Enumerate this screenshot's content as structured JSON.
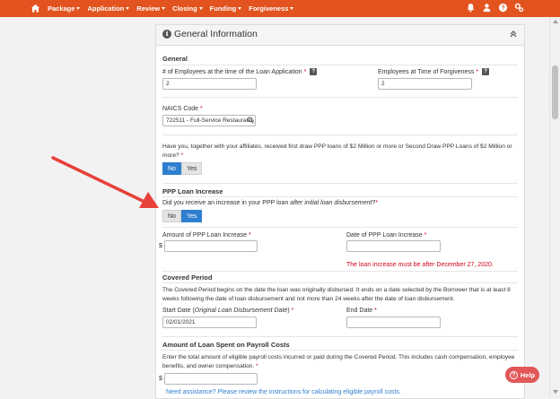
{
  "nav": {
    "items": [
      {
        "label": "Package"
      },
      {
        "label": "Application"
      },
      {
        "label": "Review"
      },
      {
        "label": "Closing"
      },
      {
        "label": "Funding"
      },
      {
        "label": "Forgiveness"
      }
    ],
    "right_icons": [
      "bell-icon",
      "user-icon",
      "question-icon",
      "settings-icon"
    ],
    "bar_color": "#e2531f"
  },
  "panel": {
    "title": "General Information",
    "general": {
      "heading": "General",
      "employees_loan_label": "# of Employees at the time of the Loan Application",
      "employees_loan_value": "2",
      "employees_forgiveness_label": "Employees at Time of Forgiveness",
      "employees_forgiveness_value": "2",
      "naics_label": "NAICS Code",
      "naics_value": "722511 - Full-Service Restaurants",
      "affiliates_question": "Have you, together with your affiliates, received first draw PPP loans of $2 Million or more or Second Draw PPP Loans of $2 Million or more?",
      "affiliates_no": "No",
      "affiliates_yes": "Yes",
      "required_mark": "*",
      "help_mark": "?"
    },
    "increase": {
      "heading": "PPP Loan Increase",
      "question_start": "Did you receive an increase in your PPP loan ",
      "question_italic": "after initial loan disbursement",
      "question_end": "?",
      "no": "No",
      "yes": "Yes",
      "amount_label": "Amount of PPP Loan Increase",
      "currency": "$",
      "date_label": "Date of PPP Loan Increase",
      "error": "The loan increase must be after December 27, 2020."
    },
    "covered": {
      "heading": "Covered Period",
      "description": "The Covered Period begins on the date the loan was originally disbursed. It ends on a date selected by the Borrower that is at least 8 weeks following the date of loan disbursement and not more than 24 weeks after the date of loan disbursement.",
      "start_label_a": "Start Date (",
      "start_label_italic": "Original Loan Disbursement Date",
      "start_label_b": ")",
      "start_value": "02/01/2021",
      "end_label": "End Date"
    },
    "payroll": {
      "heading": "Amount of Loan Spent on Payroll Costs",
      "description": "Enter the total amount of eligible payroll costs incurred or paid during the Covered Period. This includes cash compensation, employee benefits, and owner compensation.",
      "currency": "$",
      "assist_link": "Need assistance? Please review the instructions for calculating eligible payroll costs."
    }
  },
  "help_button": {
    "label": "Help"
  },
  "annotation": {
    "color": "#e8403a"
  }
}
